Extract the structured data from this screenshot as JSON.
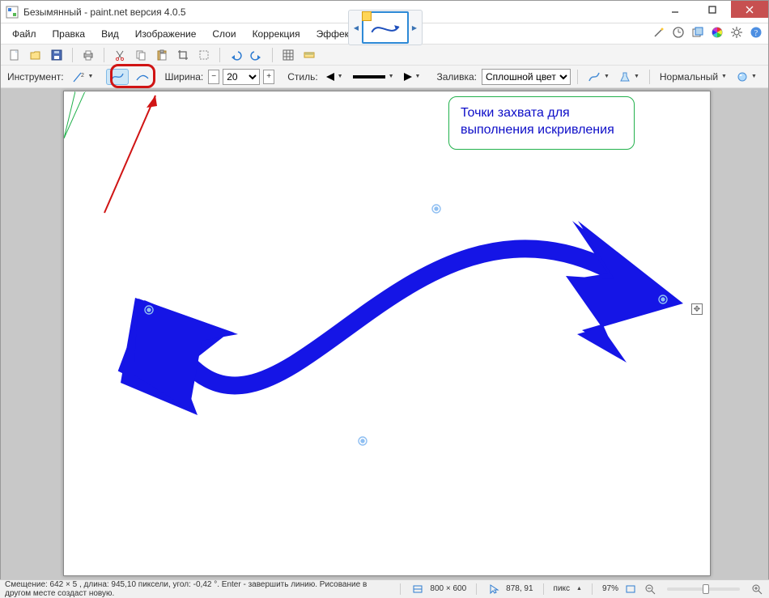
{
  "colors": {
    "accent_blue": "#1515E6",
    "highlight_red": "#D01414",
    "callout_green": "#22B14C",
    "callout_text": "#0D0DC8",
    "close_red": "#C75050"
  },
  "titlebar": {
    "title": "Безымянный - paint.net версия 4.0.5"
  },
  "menubar": {
    "items": [
      "Файл",
      "Правка",
      "Вид",
      "Изображение",
      "Слои",
      "Коррекция",
      "Эффекты"
    ],
    "right_icons": [
      "wand-icon",
      "clock-icon",
      "layers-icon",
      "color-wheel-icon",
      "gear-icon",
      "help-icon"
    ]
  },
  "icon_toolbar": {
    "icons": [
      "new-file-icon",
      "open-icon",
      "save-icon",
      "sep",
      "print-icon",
      "sep",
      "cut-icon",
      "copy-icon",
      "paste-icon",
      "crop-icon",
      "deselect-icon",
      "sep",
      "undo-icon",
      "redo-icon",
      "sep",
      "grid-icon",
      "ruler-icon"
    ]
  },
  "optionsbar": {
    "tool_label": "Инструмент:",
    "tool_icon": "line-tool-icon",
    "curve_icon": "spline-icon",
    "bezier_icon": "bezier-icon",
    "width_label": "Ширина:",
    "width_value": "20",
    "style_label": "Стиль:",
    "fill_label": "Заливка:",
    "fill_value": "Сплошной цвет",
    "blend_label": "Нормальный",
    "antialias_icon": "antialias-icon"
  },
  "canvas": {
    "callout_text": "Точки захвата для выполнения искривления"
  },
  "statusbar": {
    "hint": "Смещение: 642 × 5 , длина: 945,10 пиксели, угол: -0,42 °. Enter - завершить линию. Рисование в другом месте создаст новую.",
    "canvas_size": "800 × 600",
    "cursor_pos": "878, 91",
    "units": "пикс",
    "zoom": "97%"
  }
}
